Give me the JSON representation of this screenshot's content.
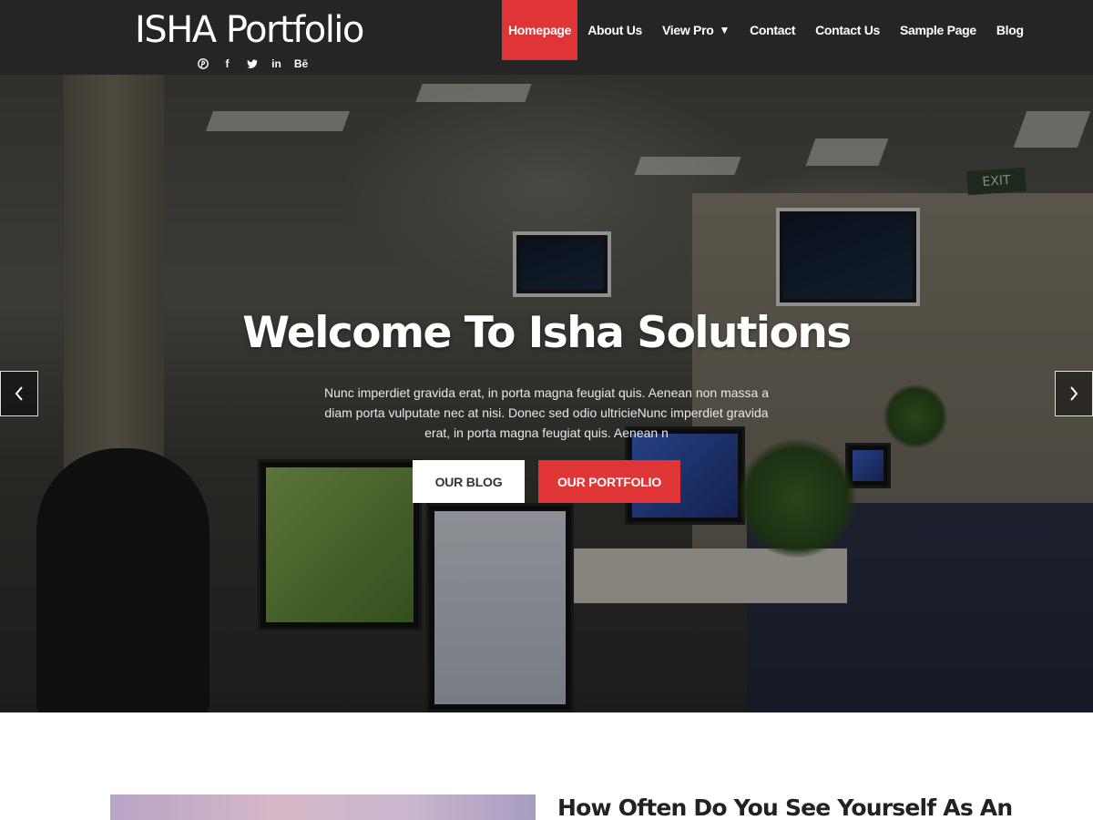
{
  "site": {
    "title": "ISHA Portfolio",
    "socials": [
      {
        "icon": "pinterest-icon",
        "glyph": "℗"
      },
      {
        "icon": "facebook-icon",
        "glyph": "f"
      },
      {
        "icon": "twitter-icon",
        "glyph": ""
      },
      {
        "icon": "linkedin-icon",
        "glyph": "in"
      },
      {
        "icon": "behance-icon",
        "glyph": "Bē"
      }
    ]
  },
  "nav": {
    "items": [
      {
        "label": "Homepage",
        "active": true
      },
      {
        "label": "About Us"
      },
      {
        "label": "View Pro",
        "caret": "▼"
      },
      {
        "label": "Contact"
      },
      {
        "label": "Contact Us"
      },
      {
        "label": "Sample Page"
      },
      {
        "label": "Blog"
      }
    ]
  },
  "hero": {
    "title": "Welcome To Isha Solutions",
    "text": "Nunc imperdiet gravida erat, in porta magna feugiat quis. Aenean non massa a diam porta vulputate nec at nisi. Donec sed odio ultricieNunc imperdiet gravida erat, in porta magna feugiat quis. Aenean n",
    "buttons": {
      "blog": "OUR BLOG",
      "portfolio": "OUR PORTFOLIO"
    },
    "exit_sign": "EXIT"
  },
  "post": {
    "title": "How Often Do You See Yourself As An"
  },
  "colors": {
    "accent": "#e03537",
    "header_bg": "#252525"
  }
}
